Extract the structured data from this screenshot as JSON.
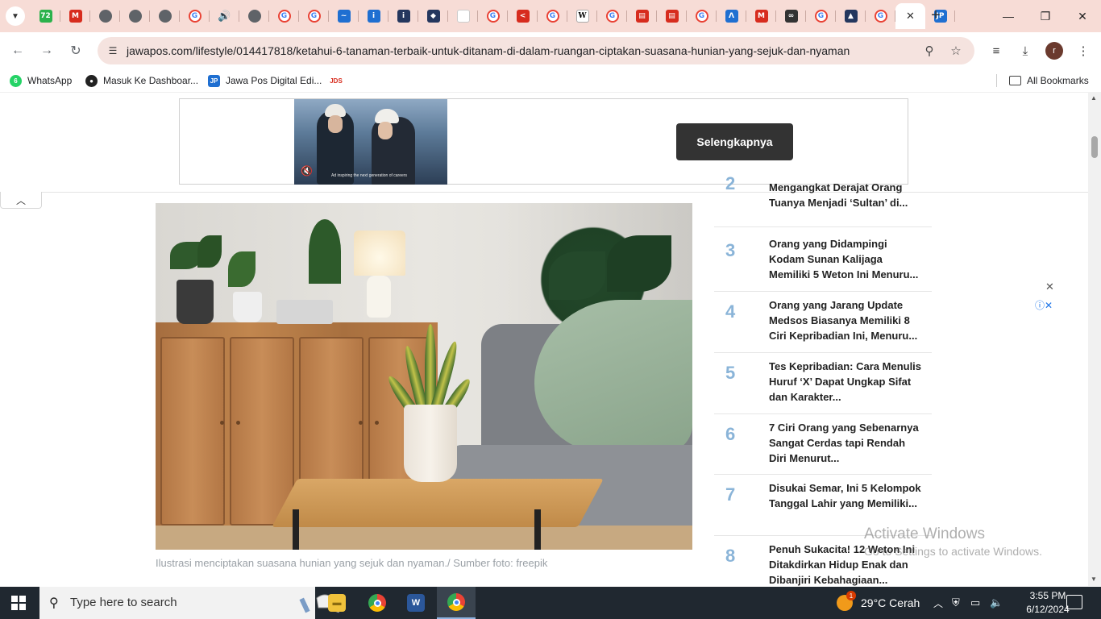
{
  "browser": {
    "tabs": [
      {
        "icon": "tab-search-icon",
        "fav": "green",
        "glyph": "72"
      },
      {
        "icon": "gmail-icon",
        "fav": "red",
        "glyph": "M"
      },
      {
        "icon": "globe-icon",
        "fav": "globe",
        "glyph": ""
      },
      {
        "icon": "globe-icon",
        "fav": "globe",
        "glyph": ""
      },
      {
        "icon": "globe-icon",
        "fav": "globe",
        "glyph": ""
      },
      {
        "icon": "google-icon",
        "fav": "g",
        "glyph": "G"
      },
      {
        "icon": "audio-icon",
        "fav": "snd",
        "glyph": "🔊"
      },
      {
        "icon": "globe-icon",
        "fav": "globe",
        "glyph": ""
      },
      {
        "icon": "google-icon",
        "fav": "g",
        "glyph": "G"
      },
      {
        "icon": "google-icon",
        "fav": "g",
        "glyph": "G"
      },
      {
        "icon": "chart-icon",
        "fav": "blue",
        "glyph": "~"
      },
      {
        "icon": "ai-icon",
        "fav": "blue",
        "glyph": "i"
      },
      {
        "icon": "ai-icon",
        "fav": "navy",
        "glyph": "i"
      },
      {
        "icon": "app-icon",
        "fav": "navy",
        "glyph": "◆"
      },
      {
        "icon": "blank-icon",
        "fav": "white",
        "glyph": ""
      },
      {
        "icon": "google-icon",
        "fav": "g",
        "glyph": "G"
      },
      {
        "icon": "arrow-icon",
        "fav": "red",
        "glyph": "<"
      },
      {
        "icon": "google-icon",
        "fav": "g",
        "glyph": "G"
      },
      {
        "icon": "wikipedia-icon",
        "fav": "wiki",
        "glyph": "W"
      },
      {
        "icon": "google-icon",
        "fav": "g",
        "glyph": "G"
      },
      {
        "icon": "app-icon",
        "fav": "red",
        "glyph": "▤"
      },
      {
        "icon": "app-icon",
        "fav": "red",
        "glyph": "▤"
      },
      {
        "icon": "google-icon",
        "fav": "g",
        "glyph": "G"
      },
      {
        "icon": "app-icon",
        "fav": "blue",
        "glyph": "Λ"
      },
      {
        "icon": "app-icon",
        "fav": "red",
        "glyph": "M"
      },
      {
        "icon": "app-icon",
        "fav": "dark",
        "glyph": "∞"
      },
      {
        "icon": "google-icon",
        "fav": "g",
        "glyph": "G"
      },
      {
        "icon": "app-icon",
        "fav": "navy",
        "glyph": "▲"
      },
      {
        "icon": "google-icon",
        "fav": "g",
        "glyph": "G"
      }
    ],
    "active_tab_close": "✕",
    "after_tab": {
      "icon": "jawapos-icon",
      "fav": "blue",
      "glyph": "JP"
    },
    "new_tab": "+",
    "window_controls": {
      "minimize": "—",
      "restore": "❐",
      "close": "✕"
    },
    "url": "jawapos.com/lifestyle/014417818/ketahui-6-tanaman-terbaik-untuk-ditanam-di-dalam-ruangan-ciptakan-suasana-hunian-yang-sejuk-dan-nyaman",
    "profile_initial": "r",
    "bookmarks": [
      {
        "label": "WhatsApp",
        "icon": "whatsapp-icon",
        "color": "#25d366",
        "glyph": "6"
      },
      {
        "label": "Masuk Ke Dashboar...",
        "icon": "dashboard-icon",
        "color": "#222222",
        "glyph": "●"
      },
      {
        "label": "Jawa Pos Digital Edi...",
        "icon": "jawapos-icon",
        "color": "#1f6fd1",
        "glyph": "JP"
      },
      {
        "label": "",
        "icon": "jds-icon",
        "color": "#ffffff",
        "glyph": "JDS"
      }
    ],
    "all_bookmarks": "All Bookmarks"
  },
  "page": {
    "ad": {
      "cta": "Selengkapnya",
      "video_caption": "Ad inspiring the next generation of careers"
    },
    "article": {
      "caption": "Ilustrasi menciptakan suasana hunian yang sejuk dan nyaman./ Sumber foto: freepik"
    },
    "trending": [
      {
        "num": "2",
        "title": "Mengangkat Derajat Orang Tuanya Menjadi ‘Sultan’ di..."
      },
      {
        "num": "3",
        "title": "Orang yang Didampingi Kodam Sunan Kalijaga Memiliki 5 Weton Ini Menuru..."
      },
      {
        "num": "4",
        "title": "Orang yang Jarang Update Medsos Biasanya Memiliki 8 Ciri Kepribadian Ini, Menuru..."
      },
      {
        "num": "5",
        "title": "Tes Kepribadian: Cara Menulis Huruf ‘X’ Dapat Ungkap Sifat dan Karakter..."
      },
      {
        "num": "6",
        "title": "7 Ciri Orang yang Sebenarnya Sangat Cerdas tapi Rendah Diri Menurut..."
      },
      {
        "num": "7",
        "title": "Disukai Semar, Ini 5 Kelompok Tanggal Lahir yang Memiliki..."
      },
      {
        "num": "8",
        "title": "Penuh Sukacita! 12 Weton Ini Ditakdirkan Hidup Enak dan Dibanjiri Kebahagiaan..."
      }
    ],
    "watermark": {
      "line1": "Activate Windows",
      "line2": "Go to Settings to activate Windows."
    }
  },
  "taskbar": {
    "search_placeholder": "Type here to search",
    "weather": "29°C  Cerah",
    "weather_badge": "1",
    "time": "3:55 PM",
    "date": "6/12/2024"
  }
}
